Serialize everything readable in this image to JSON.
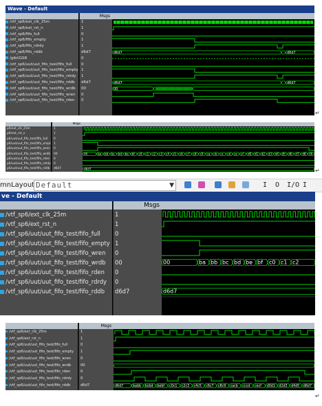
{
  "panel1": {
    "title": "Wave - Default",
    "msgs_header": "Msgs",
    "signals": [
      {
        "name": "/vtf_sp6/ext_clk_25m",
        "value": "1"
      },
      {
        "name": "/vtf_sp6/ext_rst_n",
        "value": "1"
      },
      {
        "name": "/vtf_sp6/fifo_full",
        "value": "0"
      },
      {
        "name": "/vtf_sp6/fifo_empty",
        "value": "1"
      },
      {
        "name": "/vtf_sp6/fifo_rdrdy",
        "value": "1"
      },
      {
        "name": "/vtf_sp6/fifo_rddb",
        "value": "d6d7"
      },
      {
        "name": "/glbl/GSR",
        "value": "0"
      },
      {
        "name": "/vtf_sp6/uut/uut_fifo_test/fifo_full",
        "value": "0"
      },
      {
        "name": "/vtf_sp6/uut/uut_fifo_test/fifo_empty",
        "value": "1"
      },
      {
        "name": "/vtf_sp6/uut/uut_fifo_test/fifo_rdrdy",
        "value": "1"
      },
      {
        "name": "/vtf_sp6/uut/uut_fifo_test/fifo_rddb",
        "value": "d6d7"
      },
      {
        "name": "/vtf_sp6/uut/uut_fifo_test/fifo_wrdb",
        "value": "00"
      },
      {
        "name": "/vtf_sp6/uut/uut_fifo_test/fifo_wren",
        "value": "0"
      },
      {
        "name": "/vtf_sp6/uut/uut_fifo_test/fifo_rden",
        "value": "0"
      }
    ],
    "bus_labels": {
      "rddb_a": "d6d7",
      "rddb_b": "d6d7",
      "wrdb_start": "00"
    }
  },
  "panel2": {
    "msgs_header": "Msgs",
    "signals": [
      {
        "name": "p6/ext_clk_25m",
        "value": "1"
      },
      {
        "name": "p6/ext_rst_n",
        "value": "1"
      },
      {
        "name": "p6/uut/uut_fifo_test/fifo_full",
        "value": "0"
      },
      {
        "name": "p6/uut/uut_fifo_test/fifo_empty",
        "value": "1"
      },
      {
        "name": "p6/uut/uut_fifo_test/fifo_wren",
        "value": "0"
      },
      {
        "name": "p6/uut/uut_fifo_test/fifo_wrdb",
        "value": "00"
      },
      {
        "name": "p6/uut/uut_fifo_test/fifo_rden",
        "value": "0"
      },
      {
        "name": "p6/uut/uut_fifo_test/fifo_rdrdy",
        "value": "0"
      },
      {
        "name": "p6/uut/uut_fifo_test/fifo_rddb",
        "value": "d6d7"
      }
    ],
    "wrdb_sequence": [
      "00",
      "ba",
      "bb",
      "bc",
      "bd",
      "be",
      "bf",
      "c0",
      "c1",
      "c2",
      "c3",
      "c4",
      "c5",
      "c6",
      "c7",
      "c8",
      "c9",
      "ca",
      "cb",
      "cc",
      "cd",
      "ce",
      "cf",
      "d0",
      "d1",
      "d2",
      "d3",
      "d4",
      "d5",
      "d6",
      "d7",
      "d8",
      "00"
    ],
    "rddb_label": "d6d7"
  },
  "toolbar": {
    "column_layout_label": "mnLayout",
    "layout_value": "Default",
    "btn_I": "I",
    "btn_O": "O",
    "btn_IO": "I/O",
    "btn_last": "I"
  },
  "panel3": {
    "title": "ve - Default",
    "msgs_header": "Msgs",
    "signals": [
      {
        "name": "/vtf_sp6/ext_clk_25m",
        "value": "1"
      },
      {
        "name": "/vtf_sp6/ext_rst_n",
        "value": "1"
      },
      {
        "name": "/vtf_sp6/uut/uut_fifo_test/fifo_full",
        "value": "0"
      },
      {
        "name": "/vtf_sp6/uut/uut_fifo_test/fifo_empty",
        "value": "1"
      },
      {
        "name": "/vtf_sp6/uut/uut_fifo_test/fifo_wren",
        "value": "0"
      },
      {
        "name": "/vtf_sp6/uut/uut_fifo_test/fifo_wrdb",
        "value": "00"
      },
      {
        "name": "/vtf_sp6/uut/uut_fifo_test/fifo_rden",
        "value": "0"
      },
      {
        "name": "/vtf_sp6/uut/uut_fifo_test/fifo_rdrdy",
        "value": "0"
      },
      {
        "name": "/vtf_sp6/uut/uut_fifo_test/fifo_rddb",
        "value": "d6d7"
      }
    ],
    "wrdb_sequence": [
      "00",
      "ba",
      "bb",
      "bc",
      "bd",
      "be",
      "bf",
      "c0",
      "c1",
      "c2"
    ],
    "rddb_label": "d6d7"
  },
  "panel4": {
    "msgs_header": "Msgs",
    "signals": [
      {
        "name": "/vtf_sp6/ext_clk_25m",
        "value": "1"
      },
      {
        "name": "/vtf_sp6/ext_rst_n",
        "value": "1"
      },
      {
        "name": "/vtf_sp6/uut/uut_fifo_test/fifo_full",
        "value": "0"
      },
      {
        "name": "/vtf_sp6/uut/uut_fifo_test/fifo_empty",
        "value": "1"
      },
      {
        "name": "/vtf_sp6/uut/uut_fifo_test/fifo_wren",
        "value": "0"
      },
      {
        "name": "/vtf_sp6/uut/uut_fifo_test/fifo_wrdb",
        "value": "00"
      },
      {
        "name": "/vtf_sp6/uut/uut_fifo_test/fifo_rden",
        "value": "0"
      },
      {
        "name": "/vtf_sp6/uut/uut_fifo_test/fifo_rdrdy",
        "value": "0"
      },
      {
        "name": "/vtf_sp6/uut/uut_fifo_test/fifo_rddb",
        "value": "d6d7"
      }
    ],
    "rddb_sequence": [
      "d6d7",
      "babb",
      "bcbd",
      "bebf",
      "c0c1",
      "c2c3",
      "c4c5",
      "c6c7",
      "c8c9",
      "cacb",
      "cccd",
      "cecf",
      "d0d1",
      "d2d3",
      "d4d5",
      "d6d7"
    ]
  },
  "colors": {
    "wave_green": "#00d400",
    "clk_green": "#00e000",
    "cursor_yellow": "#e8e800",
    "name_panel": "#4b4b4b",
    "header_blue": "#1a3f8a"
  },
  "return_mark": "↵"
}
